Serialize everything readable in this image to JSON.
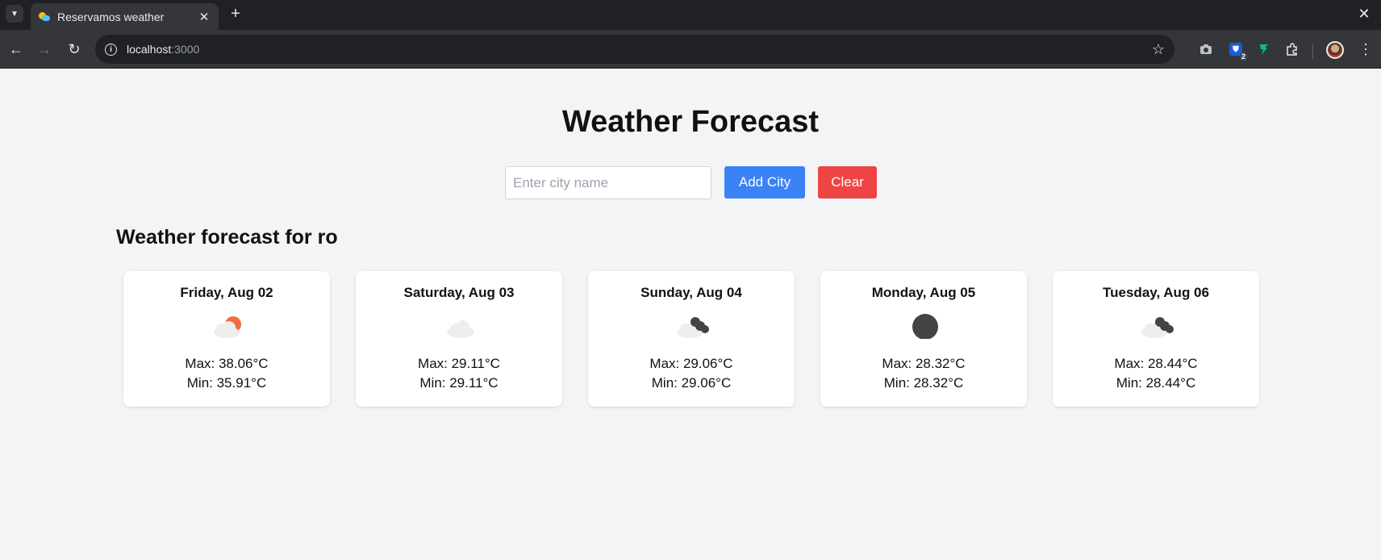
{
  "browser": {
    "tab_title": "Reservamos weather",
    "url_host": "localhost",
    "url_port": ":3000",
    "bitwarden_badge": "2"
  },
  "page": {
    "title": "Weather Forecast",
    "city_placeholder": "Enter city name",
    "city_value": "",
    "add_button": "Add City",
    "clear_button": "Clear",
    "section_title": "Weather forecast for ro"
  },
  "forecast": [
    {
      "day": "Friday, Aug 02",
      "icon": "partly-cloudy-day-icon",
      "max": "Max: 38.06°C",
      "min": "Min: 35.91°C"
    },
    {
      "day": "Saturday, Aug 03",
      "icon": "cloud-icon",
      "max": "Max: 29.11°C",
      "min": "Min: 29.11°C"
    },
    {
      "day": "Sunday, Aug 04",
      "icon": "cloudy-night-icon",
      "max": "Max: 29.06°C",
      "min": "Min: 29.06°C"
    },
    {
      "day": "Monday, Aug 05",
      "icon": "clear-night-icon",
      "max": "Max: 28.32°C",
      "min": "Min: 28.32°C"
    },
    {
      "day": "Tuesday, Aug 06",
      "icon": "cloudy-night-icon",
      "max": "Max: 28.44°C",
      "min": "Min: 28.44°C"
    }
  ],
  "colors": {
    "add_button": "#3b82f6",
    "clear_button": "#ef4444",
    "sun": "#f26b44",
    "cloud": "#eeeeee",
    "night": "#444444"
  }
}
